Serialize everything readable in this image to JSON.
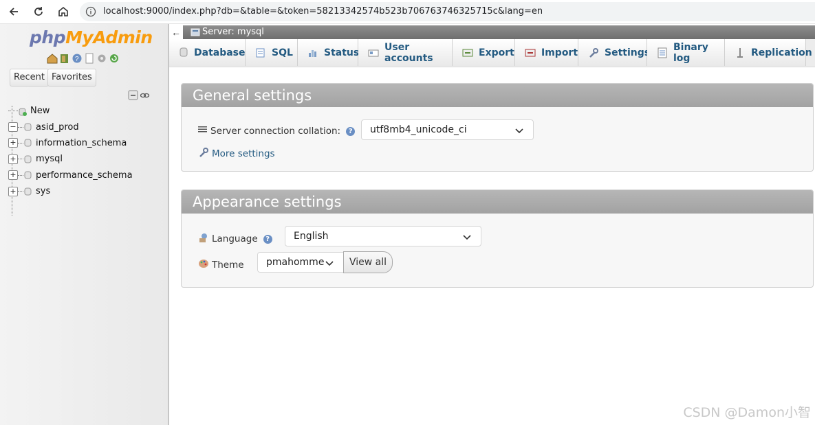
{
  "browser": {
    "url": "localhost:9000/index.php?db=&table=&token=58213342574b523b706763746325715c&lang=en"
  },
  "logo": {
    "part_a": "php",
    "part_b": "MyAdmin"
  },
  "sidebar": {
    "recent_label": "Recent",
    "favorites_label": "Favorites",
    "tree": [
      {
        "label": "New",
        "kind": "new"
      },
      {
        "label": "asid_prod",
        "kind": "expanded"
      },
      {
        "label": "information_schema",
        "kind": "collapsed"
      },
      {
        "label": "mysql",
        "kind": "collapsed"
      },
      {
        "label": "performance_schema",
        "kind": "collapsed"
      },
      {
        "label": "sys",
        "kind": "collapsed"
      }
    ]
  },
  "breadcrumb": {
    "text": "Server: mysql"
  },
  "tabs": [
    {
      "label": "Databases"
    },
    {
      "label": "SQL"
    },
    {
      "label": "Status"
    },
    {
      "label": "User accounts"
    },
    {
      "label": "Export"
    },
    {
      "label": "Import"
    },
    {
      "label": "Settings"
    },
    {
      "label": "Binary log"
    },
    {
      "label": "Replication"
    }
  ],
  "general": {
    "title": "General settings",
    "collation_label": "Server connection collation:",
    "collation_value": "utf8mb4_unicode_ci",
    "more_settings": "More settings"
  },
  "appearance": {
    "title": "Appearance settings",
    "language_label": "Language",
    "language_value": "English",
    "theme_label": "Theme",
    "theme_value": "pmahomme",
    "view_all": "View all"
  },
  "watermark": "CSDN @Damon小智",
  "colors": {
    "link": "#235a81",
    "panel_header": "#a9a9a9",
    "logo_php": "#6c78af",
    "logo_admin": "#f89c0e"
  }
}
